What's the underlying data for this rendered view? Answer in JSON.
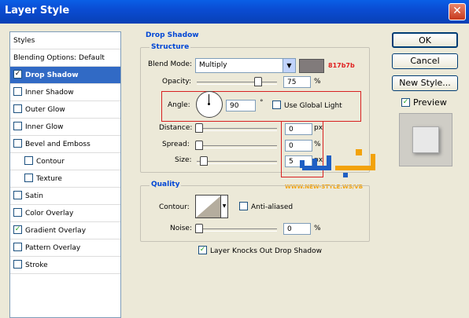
{
  "window": {
    "title": "Layer Style",
    "close_glyph": "✕"
  },
  "styles_list": {
    "header": "Styles",
    "items": [
      {
        "label": "Blending Options: Default",
        "checkbox": false,
        "checked": false
      },
      {
        "label": "Drop Shadow",
        "checkbox": true,
        "checked": true,
        "selected": true
      },
      {
        "label": "Inner Shadow",
        "checkbox": true,
        "checked": false
      },
      {
        "label": "Outer Glow",
        "checkbox": true,
        "checked": false
      },
      {
        "label": "Inner Glow",
        "checkbox": true,
        "checked": false
      },
      {
        "label": "Bevel and Emboss",
        "checkbox": true,
        "checked": false
      },
      {
        "label": "Contour",
        "checkbox": true,
        "checked": false,
        "indent": true
      },
      {
        "label": "Texture",
        "checkbox": true,
        "checked": false,
        "indent": true
      },
      {
        "label": "Satin",
        "checkbox": true,
        "checked": false
      },
      {
        "label": "Color Overlay",
        "checkbox": true,
        "checked": false
      },
      {
        "label": "Gradient Overlay",
        "checkbox": true,
        "checked": true
      },
      {
        "label": "Pattern Overlay",
        "checkbox": true,
        "checked": false
      },
      {
        "label": "Stroke",
        "checkbox": true,
        "checked": false
      }
    ]
  },
  "drop_shadow": {
    "title": "Drop Shadow",
    "structure": {
      "title": "Structure",
      "blend_mode_label": "Blend Mode:",
      "blend_mode_value": "Multiply",
      "color_hex": "817b7b",
      "color_swatch": "#817b7b",
      "opacity_label": "Opacity:",
      "opacity_value": "75",
      "opacity_percent": 75,
      "angle_label": "Angle:",
      "angle_value": "90",
      "degree_symbol": "°",
      "use_global_light_label": "Use Global Light",
      "distance_label": "Distance:",
      "distance_value": "0",
      "spread_label": "Spread:",
      "spread_value": "0",
      "size_label": "Size:",
      "size_value": "5",
      "unit_px": "px",
      "unit_percent": "%"
    },
    "quality": {
      "title": "Quality",
      "contour_label": "Contour:",
      "anti_aliased_label": "Anti-aliased",
      "noise_label": "Noise:",
      "noise_value": "0",
      "unit_percent": "%"
    },
    "knockout_label": "Layer Knocks Out Drop Shadow"
  },
  "buttons": {
    "ok": "OK",
    "cancel": "Cancel",
    "new_style": "New Style...",
    "preview": "Preview"
  },
  "watermark": {
    "url": "WWW.NEW-STYLE.WS/VB"
  }
}
